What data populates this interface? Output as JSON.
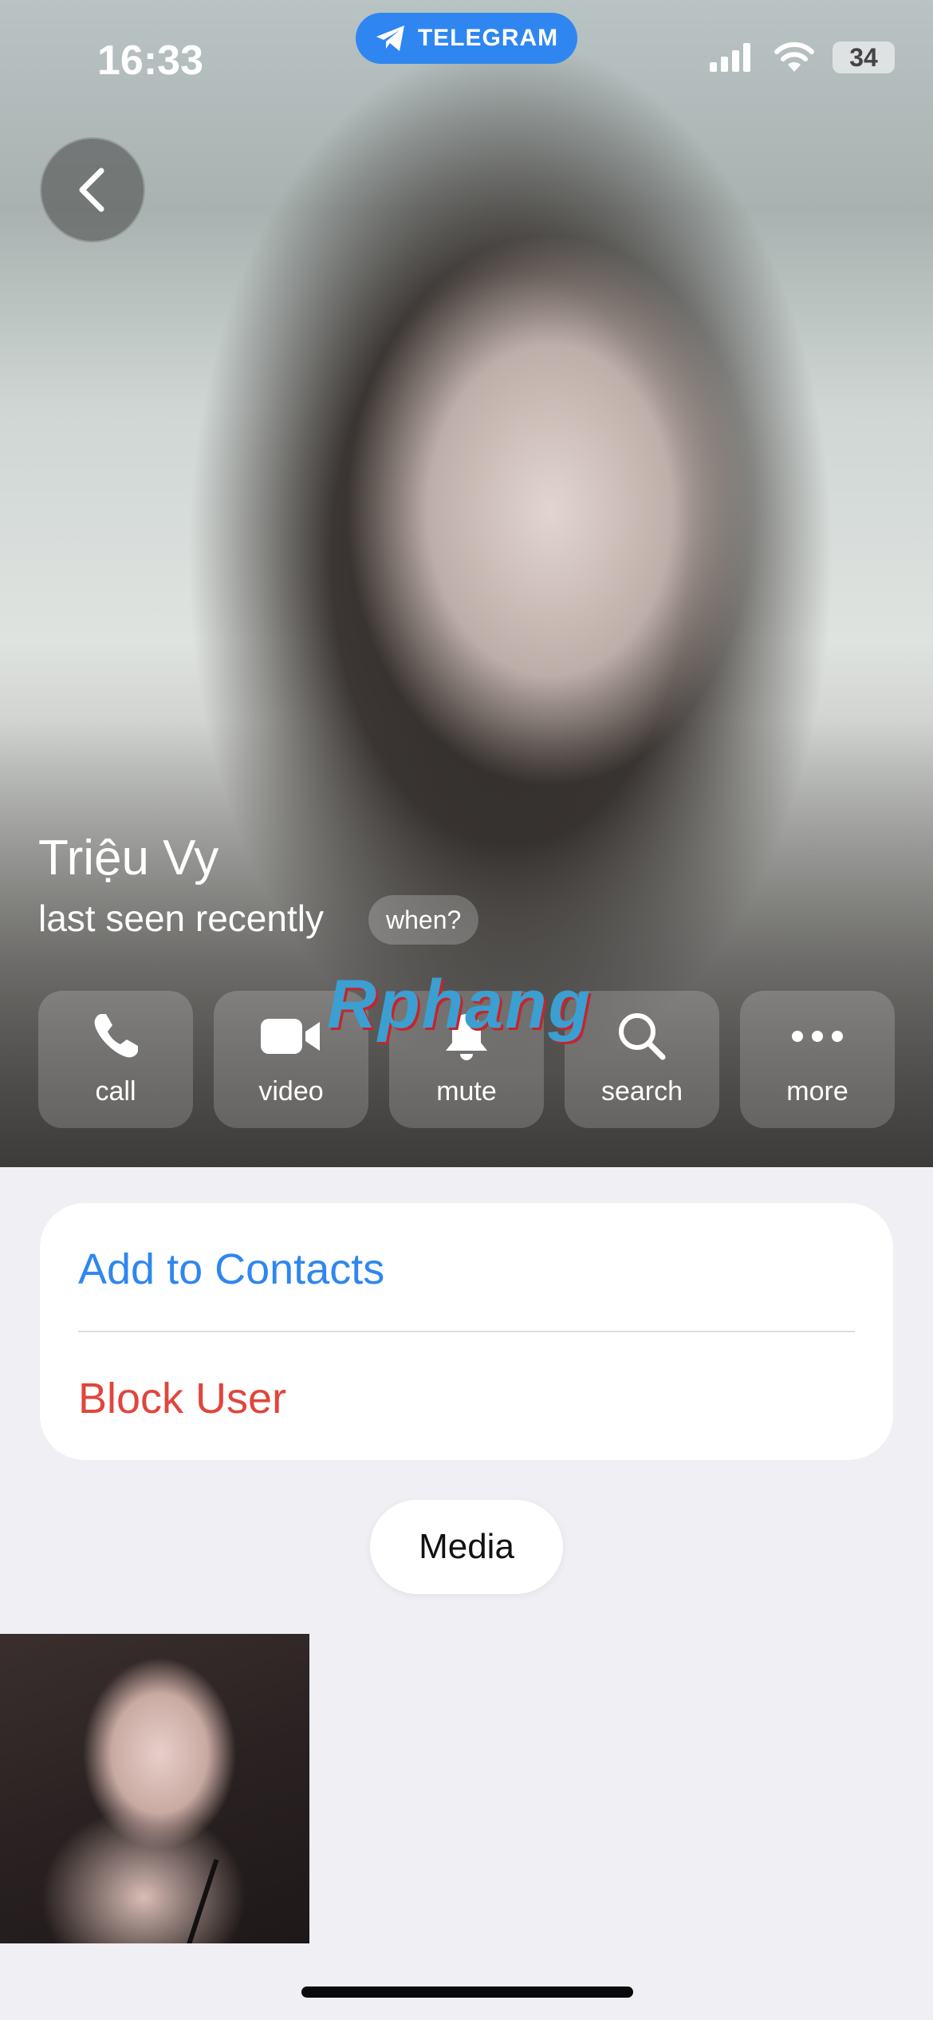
{
  "status_bar": {
    "time": "16:33",
    "live_activity_label": "TELEGRAM",
    "battery_level": "34",
    "icons": [
      "cellular-signal-icon",
      "wifi-icon",
      "battery-icon"
    ]
  },
  "profile": {
    "name": "Triệu Vy",
    "status": "last seen recently",
    "when_label": "when?",
    "watermark": "Rphang"
  },
  "actions": [
    {
      "label": "call",
      "icon": "phone-icon"
    },
    {
      "label": "video",
      "icon": "video-camera-icon"
    },
    {
      "label": "mute",
      "icon": "bell-icon"
    },
    {
      "label": "search",
      "icon": "search-icon"
    },
    {
      "label": "more",
      "icon": "ellipsis-icon"
    }
  ],
  "options": {
    "add_contact": "Add to Contacts",
    "block_user": "Block User"
  },
  "media": {
    "tab_label": "Media"
  },
  "colors": {
    "accent_blue": "#2f86f0",
    "destructive_red": "#e0463b",
    "page_background": "#efeff4"
  }
}
